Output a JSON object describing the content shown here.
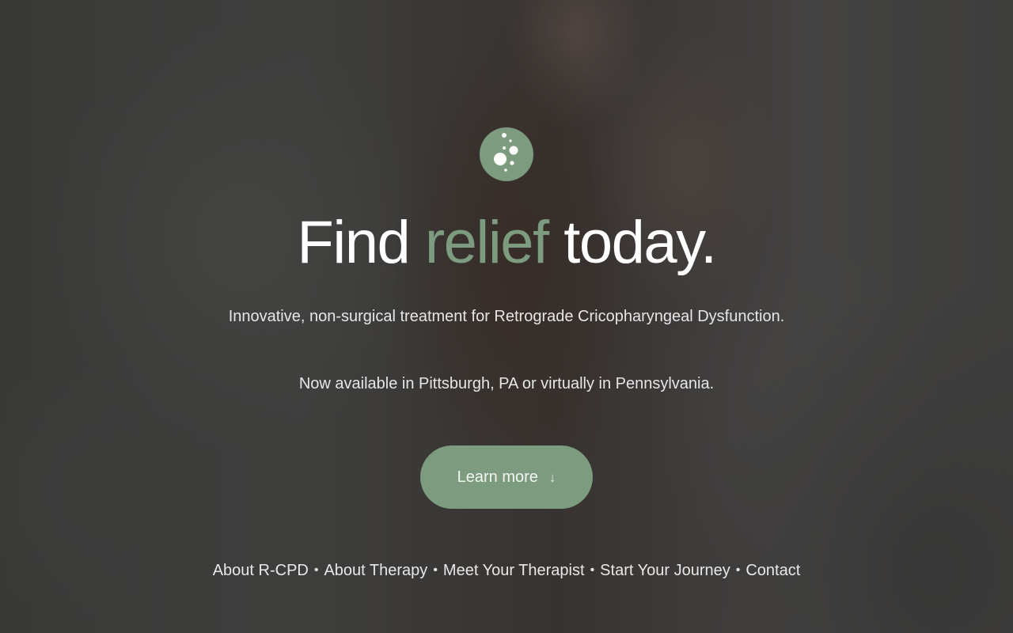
{
  "hero": {
    "headline_part1": "Find ",
    "headline_accent": "relief",
    "headline_part2": " today.",
    "subtitle": "Innovative, non-surgical treatment for Retrograde Cricopharyngeal Dysfunction.",
    "availability": "Now available in Pittsburgh, PA or virtually in Pennsylvania.",
    "cta_label": "Learn more",
    "cta_icon": "arrow-down-icon",
    "logo_icon": "bubbles-logo-icon"
  },
  "footer_nav": {
    "items": [
      {
        "label": "About R-CPD"
      },
      {
        "label": "About Therapy"
      },
      {
        "label": "Meet Your Therapist"
      },
      {
        "label": "Start Your Journey"
      },
      {
        "label": "Contact"
      }
    ],
    "separator": "•"
  },
  "colors": {
    "accent": "#7d9b7e",
    "text": "#ffffff",
    "overlay": "rgba(24,24,24,0.62)"
  }
}
